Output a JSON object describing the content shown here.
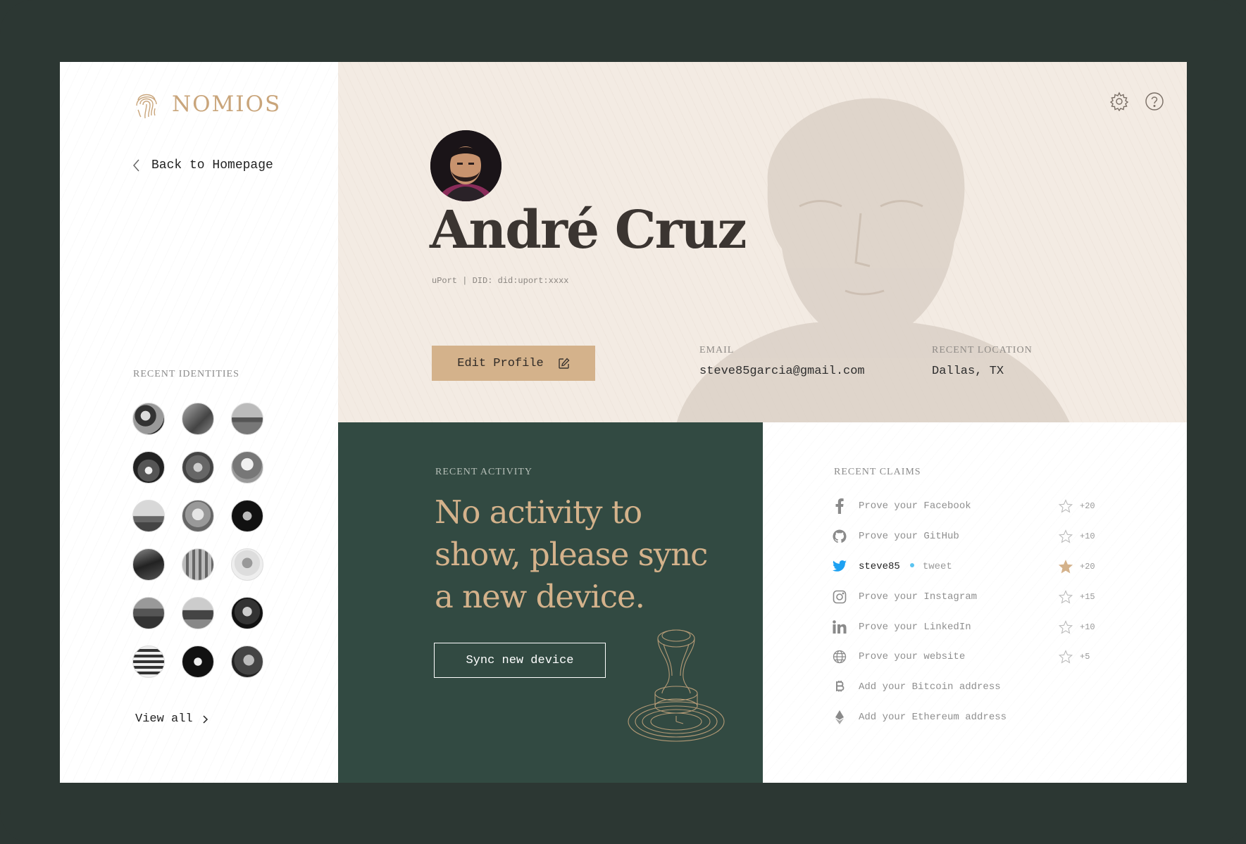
{
  "brand": {
    "name": "NOMIOS",
    "accent": "#d4b28b",
    "dark": "#324a42"
  },
  "sidebar": {
    "back_label": "Back to Homepage",
    "recent_identities_label": "RECENT IDENTITIES",
    "view_all_label": "View all"
  },
  "profile": {
    "name": "André Cruz",
    "did": "uPort | DID: did:uport:xxxx",
    "edit_label": "Edit Profile",
    "email_label": "EMAIL",
    "email": "steve85garcia@gmail.com",
    "location_label": "RECENT LOCATION",
    "location": "Dallas, TX"
  },
  "activity": {
    "label": "RECENT ACTIVITY",
    "message": "No activity to show, please sync a new device.",
    "sync_label": "Sync new device"
  },
  "claims": {
    "label": "RECENT CLAIMS",
    "items": [
      {
        "icon": "facebook-icon",
        "text": "Prove your Facebook",
        "points": "+20",
        "starred": false
      },
      {
        "icon": "github-icon",
        "text": "Prove your GitHub",
        "points": "+10",
        "starred": false
      },
      {
        "icon": "twitter-icon",
        "text": "steve85",
        "sub": "tweet",
        "points": "+20",
        "starred": true
      },
      {
        "icon": "instagram-icon",
        "text": "Prove your Instagram",
        "points": "+15",
        "starred": false
      },
      {
        "icon": "linkedin-icon",
        "text": "Prove your LinkedIn",
        "points": "+10",
        "starred": false
      },
      {
        "icon": "globe-icon",
        "text": "Prove your website",
        "points": "+5",
        "starred": false
      },
      {
        "icon": "bitcoin-icon",
        "text": "Add your Bitcoin address"
      },
      {
        "icon": "ethereum-icon",
        "text": "Add your Ethereum address"
      }
    ]
  }
}
